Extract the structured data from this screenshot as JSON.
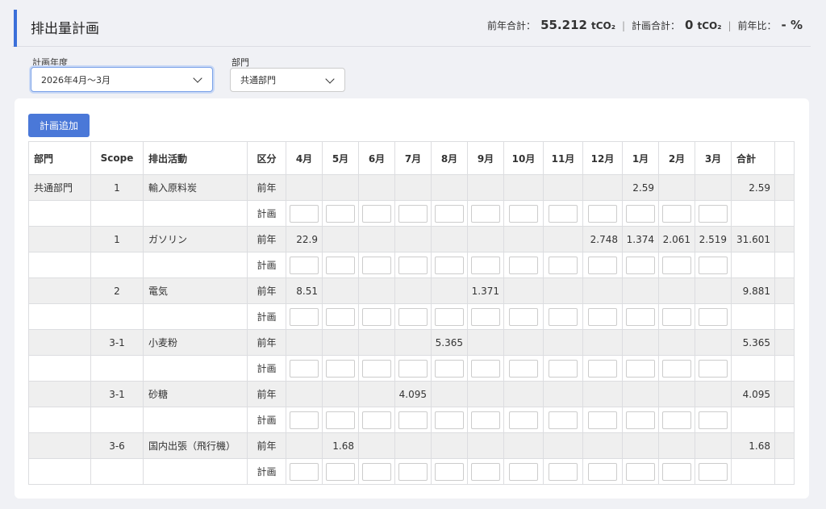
{
  "header": {
    "title": "排出量計画",
    "prev_total_label": "前年合計：",
    "prev_total_value": "55.212",
    "plan_total_label": "計画合計：",
    "plan_total_value": "0",
    "unit": "tCO₂",
    "yoy_label": "前年比：",
    "yoy_value": "- %",
    "separator": "|"
  },
  "filters": {
    "year_label": "計画年度",
    "year_value": "2026年4月〜3月",
    "dept_label": "部門",
    "dept_value": "共通部門"
  },
  "add_button": "計画追加",
  "table": {
    "headers": [
      "部門",
      "Scope",
      "排出活動",
      "区分",
      "4月",
      "5月",
      "6月",
      "7月",
      "8月",
      "9月",
      "10月",
      "11月",
      "12月",
      "1月",
      "2月",
      "3月",
      "合計"
    ],
    "prev_label": "前年",
    "plan_label": "計画",
    "rows": [
      {
        "dept": "共通部門",
        "scope": "1",
        "activity": "輸入原料炭",
        "months": [
          "",
          "",
          "",
          "",
          "",
          "",
          "",
          "",
          "",
          "2.59",
          "",
          ""
        ],
        "total": "2.59"
      },
      {
        "dept": "",
        "scope": "1",
        "activity": "ガソリン",
        "months": [
          "22.9",
          "",
          "",
          "",
          "",
          "",
          "",
          "",
          "2.748",
          "1.374",
          "2.061",
          "2.519"
        ],
        "total": "31.601"
      },
      {
        "dept": "",
        "scope": "2",
        "activity": "電気",
        "months": [
          "8.51",
          "",
          "",
          "",
          "",
          "1.371",
          "",
          "",
          "",
          "",
          "",
          ""
        ],
        "total": "9.881"
      },
      {
        "dept": "",
        "scope": "3-1",
        "activity": "小麦粉",
        "months": [
          "",
          "",
          "",
          "",
          "5.365",
          "",
          "",
          "",
          "",
          "",
          "",
          ""
        ],
        "total": "5.365"
      },
      {
        "dept": "",
        "scope": "3-1",
        "activity": "砂糖",
        "months": [
          "",
          "",
          "",
          "4.095",
          "",
          "",
          "",
          "",
          "",
          "",
          "",
          ""
        ],
        "total": "4.095"
      },
      {
        "dept": "",
        "scope": "3-6",
        "activity": "国内出張（飛行機）",
        "months": [
          "",
          "1.68",
          "",
          "",
          "",
          "",
          "",
          "",
          "",
          "",
          "",
          ""
        ],
        "total": "1.68"
      }
    ]
  }
}
